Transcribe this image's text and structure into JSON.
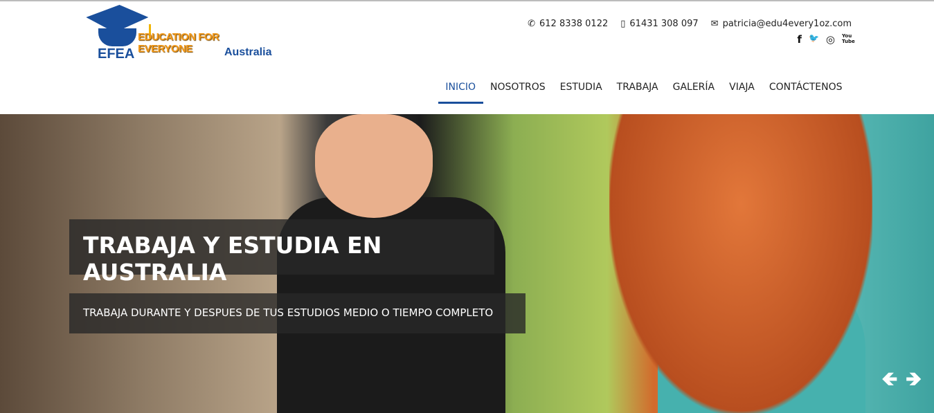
{
  "logo": {
    "abbr": "EFEA",
    "tagline": "EDUCATION FOR EVERYONE",
    "country": "Australia"
  },
  "contacts": {
    "phone": "612 8338 0122",
    "mobile": "61431 308 097",
    "email": "patricia@edu4every1oz.com"
  },
  "social": {
    "facebook": "f",
    "twitter": "🐦",
    "instagram": "◎",
    "youtube": "You Tube"
  },
  "nav": [
    {
      "label": "INICIO"
    },
    {
      "label": "NOSOTROS"
    },
    {
      "label": "ESTUDIA"
    },
    {
      "label": "TRABAJA"
    },
    {
      "label": "GALERÍA"
    },
    {
      "label": "VIAJA"
    },
    {
      "label": "CONTÁCTENOS"
    }
  ],
  "hero": {
    "title": "TRABAJA Y ESTUDIA EN AUSTRALIA",
    "subtitle": "TRABAJA DURANTE Y DESPUES DE TUS ESTUDIOS MEDIO O TIEMPO COMPLETO",
    "prev": "🡸",
    "next": "🡺"
  }
}
